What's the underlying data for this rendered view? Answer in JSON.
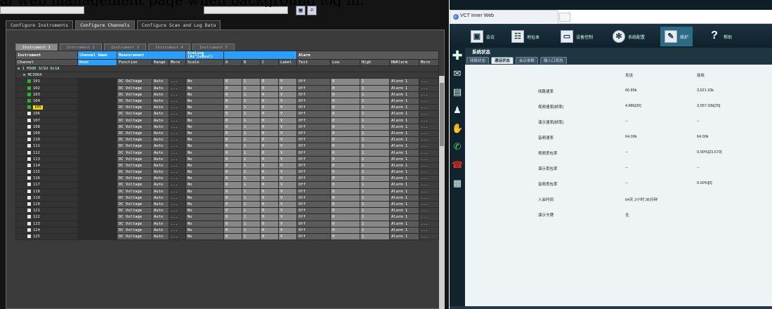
{
  "caption": "al web management page when background log in.",
  "instrument_app": {
    "main_tabs": [
      "Configure Instruments",
      "Configure Channels",
      "Configure Scan and Log Data"
    ],
    "active_main_tab": 1,
    "instrument_tabs": [
      "Instrument 1",
      "Instrument 2",
      "Instrument 3",
      "Instrument 4",
      "Instrument 5"
    ],
    "active_instrument_tab": 0,
    "header_groups": {
      "instrument": "Instrument",
      "channel_name": "Channel Name",
      "measurement": "Measurement",
      "scaling": "Scaling (Ax^2+Bx+C)",
      "alarm": "Alarm"
    },
    "columns": [
      "Channel",
      "Name",
      "Function",
      "Range",
      "More",
      "Scale",
      "A",
      "B",
      "C",
      "Label",
      "Test",
      "Low",
      "High",
      "HWAlarm",
      "More"
    ],
    "tree": {
      "root": "1 M300 SCSU Ox1A",
      "module": "MC3064"
    },
    "channels": [
      {
        "num": "101",
        "checked": true
      },
      {
        "num": "102",
        "checked": true
      },
      {
        "num": "103",
        "checked": true
      },
      {
        "num": "104",
        "checked": true
      },
      {
        "num": "105",
        "checked": true,
        "highlight": true
      },
      {
        "num": "106",
        "checked": false
      },
      {
        "num": "107",
        "checked": false
      },
      {
        "num": "108",
        "checked": false
      },
      {
        "num": "109",
        "checked": false
      },
      {
        "num": "110",
        "checked": false
      },
      {
        "num": "111",
        "checked": false
      },
      {
        "num": "112",
        "checked": false
      },
      {
        "num": "113",
        "checked": false
      },
      {
        "num": "114",
        "checked": false
      },
      {
        "num": "115",
        "checked": false
      },
      {
        "num": "116",
        "checked": false
      },
      {
        "num": "117",
        "checked": false
      },
      {
        "num": "118",
        "checked": false
      },
      {
        "num": "119",
        "checked": false
      },
      {
        "num": "120",
        "checked": false
      },
      {
        "num": "121",
        "checked": false
      },
      {
        "num": "122",
        "checked": false
      },
      {
        "num": "123",
        "checked": false
      },
      {
        "num": "124",
        "checked": false
      },
      {
        "num": "125",
        "checked": false
      }
    ],
    "row_values": {
      "function": "DC Voltage",
      "range": "Auto",
      "more": "...",
      "scale": "No",
      "a": "0",
      "b": "1",
      "c": "0",
      "label": "V",
      "test": "Off",
      "low": "0",
      "high": "1",
      "hwalarm": "Alarm 1",
      "more2": "..."
    }
  },
  "web_app": {
    "window_tab_title": "VCT Inner Web",
    "nav": [
      {
        "label": "会议",
        "icon": "meeting-icon"
      },
      {
        "label": "地址本",
        "icon": "address-book-icon"
      },
      {
        "label": "设备控制",
        "icon": "monitor-icon"
      },
      {
        "label": "系统配置",
        "icon": "gear-icon"
      },
      {
        "label": "维护",
        "icon": "wrench-icon"
      },
      {
        "label": "帮助",
        "icon": "help-icon"
      }
    ],
    "active_nav": 4,
    "section_title": "系统状态",
    "sub_tabs": [
      "线路状态",
      "通话状态",
      "会议参数",
      "输入口状态"
    ],
    "active_sub_tab": 1,
    "col_send": "发送",
    "col_recv": "接收",
    "stats": [
      {
        "label": "线路速率",
        "send": "66.80k",
        "recv": "3,621.33k"
      },
      {
        "label": "视频速率[帧率]",
        "send": "4.88k[30]",
        "recv": "3,557.33k[25]"
      },
      {
        "label": "演示速率[帧率]",
        "send": "--",
        "recv": "--"
      },
      {
        "label": "音频速率",
        "send": "64.00k",
        "recv": "64.00k"
      },
      {
        "label": "视频丢包率",
        "send": "--",
        "recv": "0.00%[23,670]"
      },
      {
        "label": "演示丢包率",
        "send": "--",
        "recv": "--"
      },
      {
        "label": "音频丢包率",
        "send": "--",
        "recv": "0.00%[0]"
      },
      {
        "label": "入会时间",
        "send": "64天 2小时 36分钟",
        "recv": ""
      },
      {
        "label": "演示令牌",
        "send": "无",
        "recv": ""
      }
    ]
  }
}
